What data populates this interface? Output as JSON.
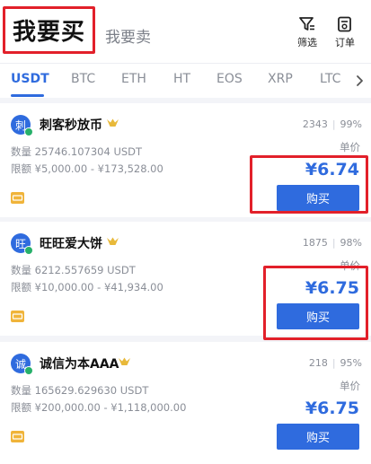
{
  "header": {
    "tab_buy": "我要买",
    "tab_sell": "我要卖",
    "filter_label": "筛选",
    "order_label": "订单"
  },
  "coins": [
    "USDT",
    "BTC",
    "ETH",
    "HT",
    "EOS",
    "XRP",
    "LTC"
  ],
  "active_coin": "USDT",
  "colors": {
    "accent": "#2f6bde",
    "highlight": "#e2202a",
    "online": "#27b06a",
    "pay_icon": "#f0b43a",
    "verified": "#e8b93a"
  },
  "listings": [
    {
      "avatar": "刺",
      "name": "刺客秒放币",
      "trades": "2343",
      "rate": "99%",
      "quantity": "数量 25746.107304 USDT",
      "limit": "限额 ¥5,000.00 - ¥173,528.00",
      "price_label": "单价",
      "price": "¥6.74",
      "buy_label": "购买"
    },
    {
      "avatar": "旺",
      "name": "旺旺爱大饼",
      "trades": "1875",
      "rate": "98%",
      "quantity": "数量 6212.557659 USDT",
      "limit": "限额 ¥10,000.00 - ¥41,934.00",
      "price_label": "单价",
      "price": "¥6.75",
      "buy_label": "购买"
    },
    {
      "avatar": "诚",
      "name": "诚信为本AAA",
      "trades": "218",
      "rate": "95%",
      "quantity": "数量 165629.629630 USDT",
      "limit": "限额 ¥200,000.00 - ¥1,118,000.00",
      "price_label": "单价",
      "price": "¥6.75",
      "buy_label": "购买"
    }
  ]
}
